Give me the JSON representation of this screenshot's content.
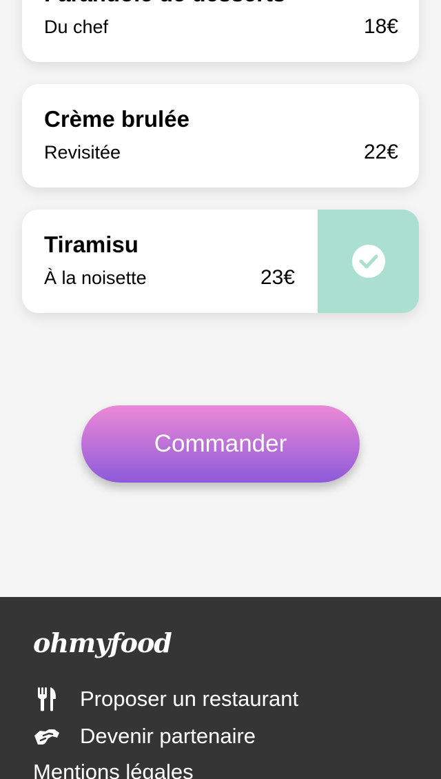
{
  "dishes": [
    {
      "name": "Farandole de desserts",
      "description": "Du chef",
      "price": "18€",
      "selected": false
    },
    {
      "name": "Crème brulée",
      "description": "Revisitée",
      "price": "22€",
      "selected": false
    },
    {
      "name": "Tiramisu",
      "description": "À la noisette",
      "price": "23€",
      "selected": true
    }
  ],
  "order": {
    "button_label": "Commander"
  },
  "footer": {
    "logo": "ohmyfood",
    "links": [
      {
        "label": "Proposer un restaurant",
        "icon": "utensils-icon"
      },
      {
        "label": "Devenir partenaire",
        "icon": "handshake-icon"
      },
      {
        "label": "Mentions légales",
        "icon": ""
      }
    ]
  },
  "colors": {
    "background": "#f5f5f5",
    "card": "#ffffff",
    "check_panel": "#abe0d1",
    "button_gradient_top": "#ec89d6",
    "button_gradient_bottom": "#8e5ad9",
    "footer": "#353535"
  }
}
